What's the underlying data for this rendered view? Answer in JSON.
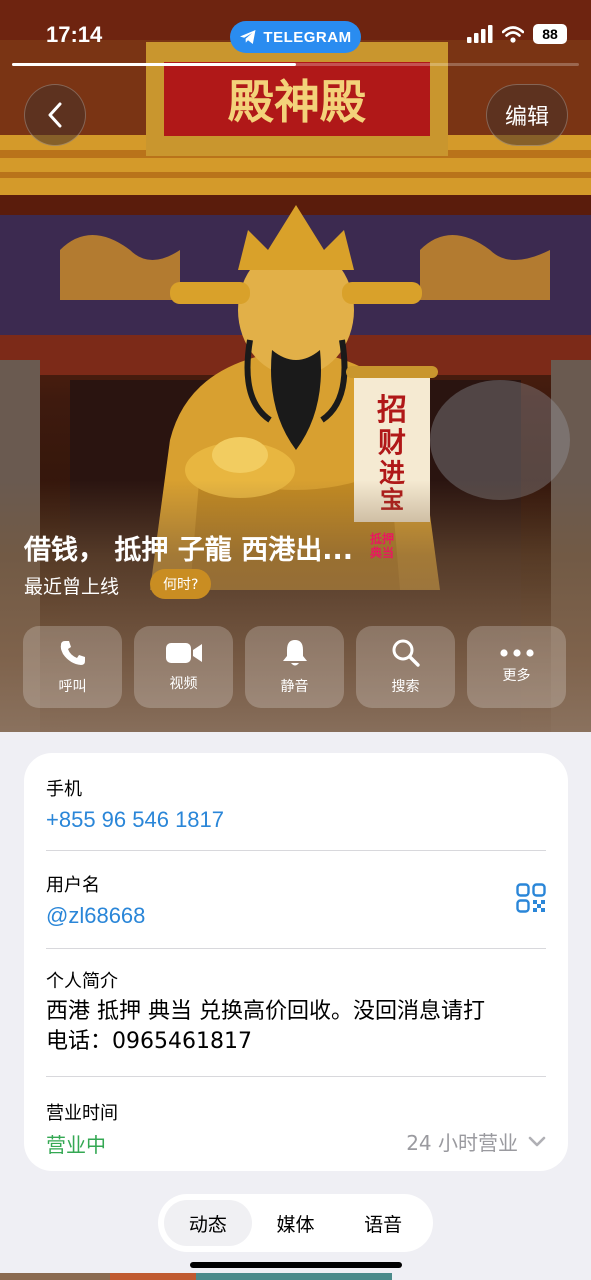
{
  "status_bar": {
    "time": "17:14",
    "app_pill": "TELEGRAM",
    "battery": "88",
    "media_progress": 0.5
  },
  "header": {
    "back_icon": "chevron-left-icon",
    "edit_label": "编辑"
  },
  "hero_image": {
    "plaque_text": "殿神殿",
    "scroll_text": [
      "招",
      "财",
      "进",
      "宝"
    ]
  },
  "profile": {
    "name": "借钱， 抵押 子龍 西港出...",
    "badge_line1": "抵押",
    "badge_line2": "典当",
    "last_seen": "最近曾上线",
    "when_label": "何时?"
  },
  "actions": [
    {
      "icon": "phone-icon",
      "label": "呼叫"
    },
    {
      "icon": "video-icon",
      "label": "视频"
    },
    {
      "icon": "bell-icon",
      "label": "静音"
    },
    {
      "icon": "search-icon",
      "label": "搜索"
    },
    {
      "icon": "more-icon",
      "label": "更多"
    }
  ],
  "info": {
    "phone_label": "手机",
    "phone_value": "+855 96 546 1817",
    "username_label": "用户名",
    "username_value": "@zl68668",
    "bio_label": "个人简介",
    "bio_line1": "西港 抵押 典当 兑换高价回收。没回消息请打",
    "bio_line2": "电话：0965461817",
    "hours_label": "营业时间",
    "hours_status": "营业中",
    "hours_detail": "24 小时营业"
  },
  "tabs": [
    {
      "label": "动态",
      "active": true
    },
    {
      "label": "媒体",
      "active": false
    },
    {
      "label": "语音",
      "active": false
    }
  ],
  "colors": {
    "link_blue": "#2a86d8",
    "open_green": "#34a853",
    "telegram_blue": "#2a8cf0",
    "when_pill": "#c98d22",
    "badge_pink": "#e8195e"
  }
}
